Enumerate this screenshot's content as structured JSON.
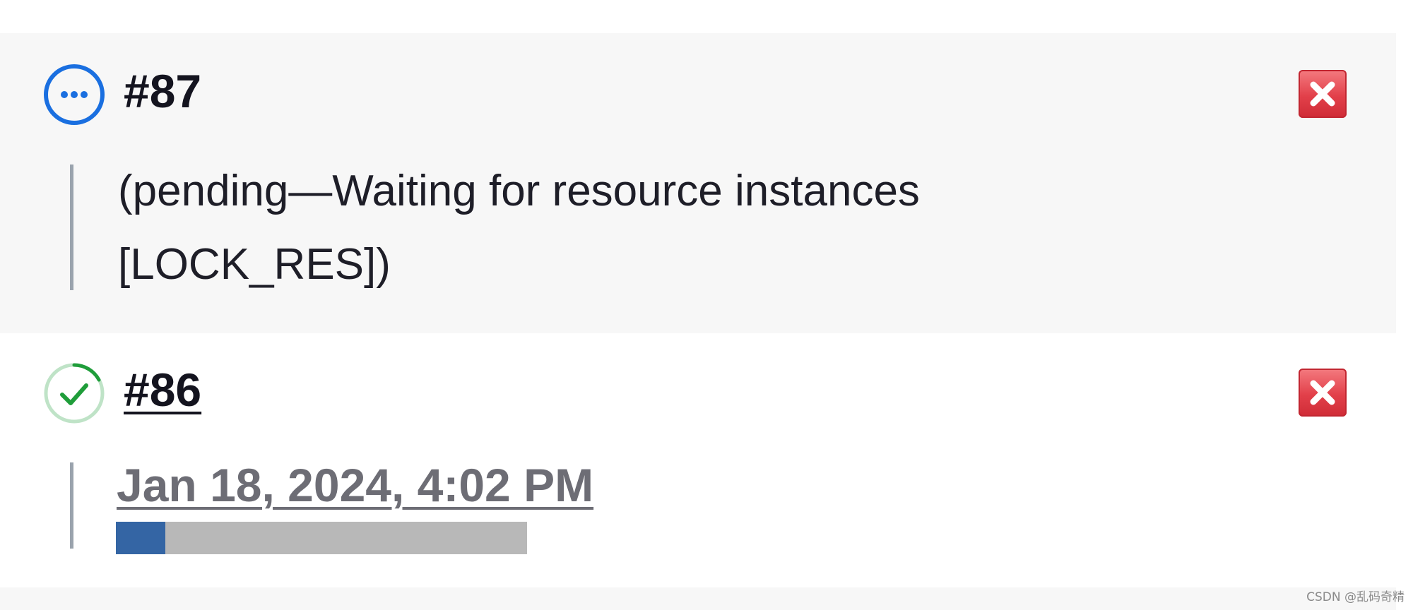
{
  "builds": [
    {
      "number": "#87",
      "status": "pending",
      "status_icon": "pending-dots-icon",
      "message_line1": "(pending—Waiting for resource instances",
      "message_line2": "[LOCK_RES])",
      "abort_icon": "close-icon"
    },
    {
      "number": "#86",
      "status": "success",
      "status_icon": "check-circle-icon",
      "timestamp": "Jan 18, 2024, 4:02 PM",
      "progress_fraction": 0.12,
      "abort_icon": "close-icon"
    }
  ],
  "colors": {
    "pending_blue": "#1a6fe0",
    "success_green": "#1f9d3a",
    "abort_red": "#e2404a",
    "progress_blue": "#3465a4",
    "progress_track": "#b8b8b8"
  },
  "watermark": "CSDN @乱码奇精"
}
